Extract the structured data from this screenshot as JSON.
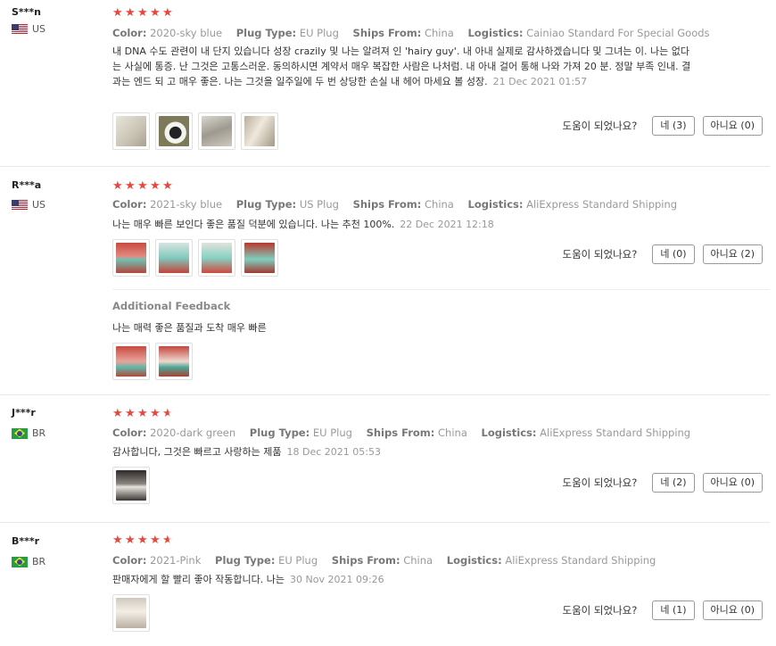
{
  "labels": {
    "color": "Color:",
    "plug_type": "Plug Type:",
    "ships_from": "Ships From:",
    "logistics": "Logistics:",
    "helpful_question": "도움이 되었나요?",
    "additional_feedback": "Additional Feedback"
  },
  "colors": {
    "star": "#f44336",
    "border": "#e8e8e8"
  },
  "reviews": [
    {
      "user": "S***n",
      "country": "US",
      "flag": "us-flag",
      "rating": 5,
      "color": "2020-sky blue",
      "plug_type": "EU Plug",
      "ships_from": "China",
      "logistics": "Cainiao Standard For Special Goods",
      "text": "내 DNA 수도 관련이 내 단지 있습니다 성장 crazily 및 나는 알려져 인 'hairy guy'. 내 아내 실제로 감사하겠습니다 및 그녀는 이. 나는 없다는 사실에 통증. 난 그것은 고통스러운. 동의하시면 계약서 매우 복잡한 사람은 나처럼. 내 아내 걸어 통해 나와 가져 20 분. 정말 부족 인내. 결과는 엔드 되 고 매우 좋은. 나는 그것을 일주일에 두 번 상당한 손실 내 헤어 마세요 볼 성장.",
      "date": "21 Dec 2021 01:57",
      "thumbs": [
        "product-photo",
        "product-photo",
        "product-photo",
        "product-photo"
      ],
      "yes": "네 (3)",
      "no": "아니요 (0)"
    },
    {
      "user": "R***a",
      "country": "US",
      "flag": "us-flag",
      "rating": 5,
      "color": "2021-sky blue",
      "plug_type": "US Plug",
      "ships_from": "China",
      "logistics": "AliExpress Standard Shipping",
      "text": "나는 매우 빠른 보인다 좋은 품질 덕분에 있습니다. 나는 추천 100%.",
      "date": "22 Dec 2021 12:18",
      "thumbs": [
        "product-photo",
        "product-photo",
        "product-photo",
        "product-photo"
      ],
      "yes": "네 (0)",
      "no": "아니요 (2)",
      "additional_text": "나는 매력 좋은 품질과 도착 매우 빠른",
      "additional_thumbs": [
        "product-photo",
        "product-photo"
      ]
    },
    {
      "user": "J***r",
      "country": "BR",
      "flag": "br-flag",
      "rating": 4.5,
      "color": "2020-dark green",
      "plug_type": "EU Plug",
      "ships_from": "China",
      "logistics": "AliExpress Standard Shipping",
      "text": "감사합니다, 그것은 빠르고 사랑하는 제품",
      "date": "18 Dec 2021 05:53",
      "thumbs": [
        "product-photo"
      ],
      "yes": "네 (2)",
      "no": "아니요 (0)"
    },
    {
      "user": "B***r",
      "country": "BR",
      "flag": "br-flag",
      "rating": 4.5,
      "color": "2021-Pink",
      "plug_type": "EU Plug",
      "ships_from": "China",
      "logistics": "AliExpress Standard Shipping",
      "text": "판매자에게 할 빨리 좋아 작동합니다. 나는",
      "date": "30 Nov 2021 09:26",
      "thumbs": [
        "product-photo"
      ],
      "yes": "네 (1)",
      "no": "아니요 (0)"
    }
  ]
}
